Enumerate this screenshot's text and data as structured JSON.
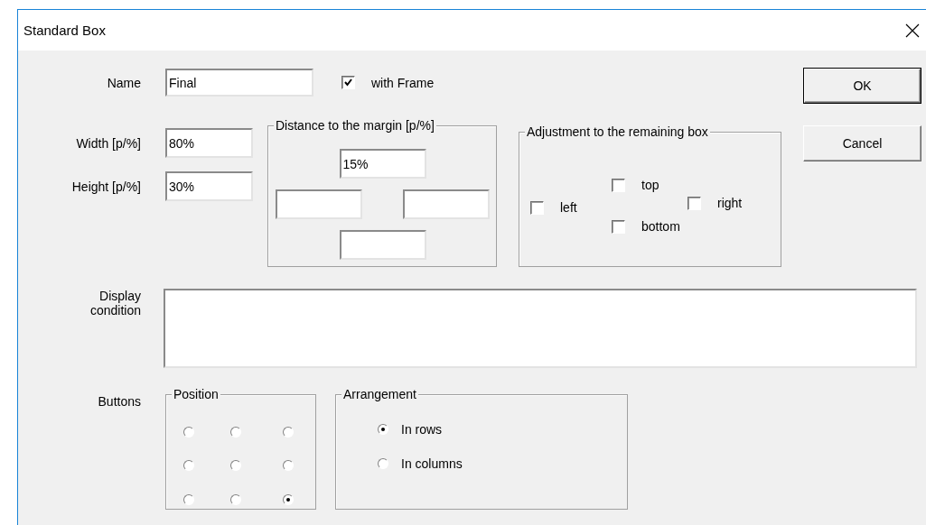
{
  "window": {
    "title": "Standard Box"
  },
  "name": {
    "label": "Name",
    "value": "Final"
  },
  "with_frame": {
    "label": "with Frame",
    "checked": true
  },
  "size_fields": [
    {
      "label": "Width [p/%]",
      "value": "80%"
    },
    {
      "label": "Height [p/%]",
      "value": "30%"
    }
  ],
  "distance": {
    "title": "Distance to the margin [p/%]",
    "fields": [
      {
        "kind": "top",
        "value": "15%"
      },
      {
        "kind": "left"
      },
      {
        "kind": "right"
      },
      {
        "kind": "bottom"
      }
    ]
  },
  "adjustment": {
    "title": "Adjustment to the remaining box",
    "options": [
      {
        "kind": "top",
        "label": "top",
        "checked": false
      },
      {
        "kind": "left",
        "label": "left",
        "checked": false
      },
      {
        "kind": "right",
        "label": "right",
        "checked": false
      },
      {
        "kind": "bottom",
        "label": "bottom",
        "checked": false
      }
    ]
  },
  "display_condition": {
    "label": "Display condition"
  },
  "buttons_section": {
    "label": "Buttons",
    "position": {
      "title": "Position",
      "options": [
        {
          "selected": false
        },
        {
          "selected": false
        },
        {
          "selected": false
        },
        {
          "selected": false
        },
        {
          "selected": false
        },
        {
          "selected": false
        },
        {
          "selected": false
        },
        {
          "selected": false
        },
        {
          "selected": true
        }
      ]
    },
    "arrangement": {
      "title": "Arrangement",
      "options": [
        {
          "label": "In rows",
          "selected": true
        },
        {
          "label": "In columns",
          "selected": false
        }
      ]
    }
  },
  "actions": [
    {
      "label": "OK",
      "default": true
    },
    {
      "label": "Cancel",
      "default": false
    }
  ]
}
